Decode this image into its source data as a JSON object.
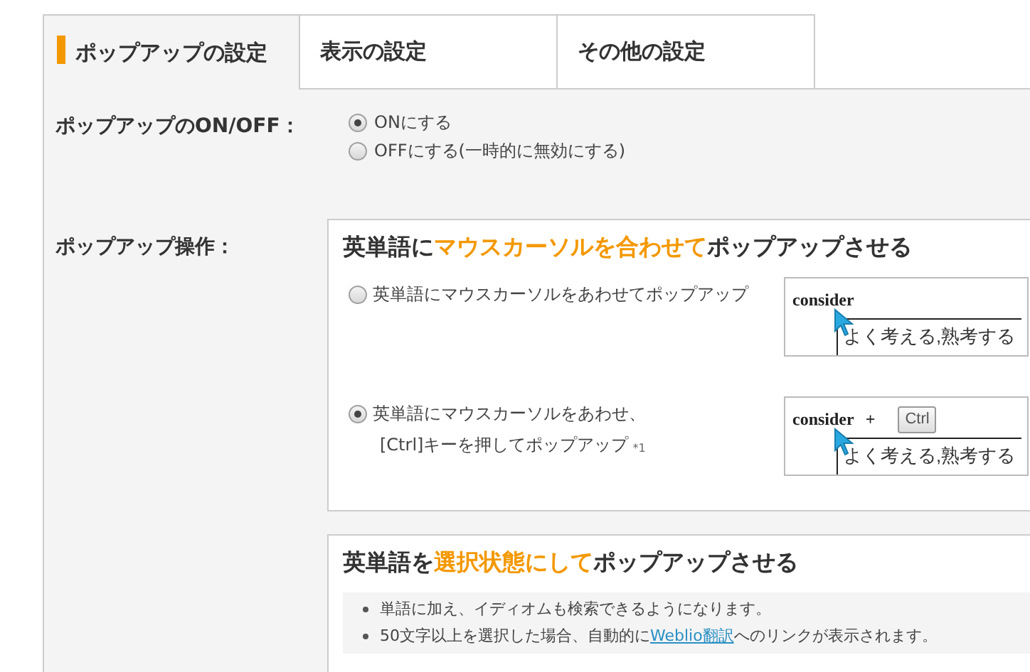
{
  "tabs": [
    {
      "label": "ポップアップの設定",
      "selected": true
    },
    {
      "label": "表示の設定",
      "selected": false
    },
    {
      "label": "その他の設定",
      "selected": false
    }
  ],
  "onoff": {
    "label": "ポップアップのON/OFF：",
    "options": [
      {
        "label": "ONにする",
        "selected": true
      },
      {
        "label": "OFFにする(一時的に無効にする)",
        "selected": false
      }
    ]
  },
  "operation": {
    "label": "ポップアップ操作：",
    "mouseover_section": {
      "heading": [
        {
          "text": "英単語に",
          "highlight": false
        },
        {
          "text": "マウスカーソルを合わせて",
          "highlight": true
        },
        {
          "text": "ポップアップさせる",
          "highlight": false
        }
      ],
      "options": [
        {
          "label": "英単語にマウスカーソルをあわせてポップアップ",
          "selected": false,
          "example": {
            "word": "consider",
            "translation": "よく考える,熟考する"
          }
        },
        {
          "label": "英単語にマウスカーソルをあわせ、",
          "label_line_2": "[Ctrl]キーを押してポップアップ",
          "note": "*1",
          "selected": true,
          "example": {
            "word": "consider",
            "plus": "+",
            "key": "Ctrl",
            "translation": "よく考える,熟考する"
          }
        }
      ]
    },
    "selection_section": {
      "heading": [
        {
          "text": "英単語を",
          "highlight": false
        },
        {
          "text": "選択状態にして",
          "highlight": true
        },
        {
          "text": "ポップアップさせる",
          "highlight": false
        }
      ],
      "notes": [
        {
          "text": "単語に加え、イディオムも検索できるようになります。"
        },
        {
          "text": "50文字以上を選択した場合、自動的に",
          "link": "Weblio翻訳",
          "text_after": "へのリンクが表示されます。"
        }
      ]
    }
  }
}
